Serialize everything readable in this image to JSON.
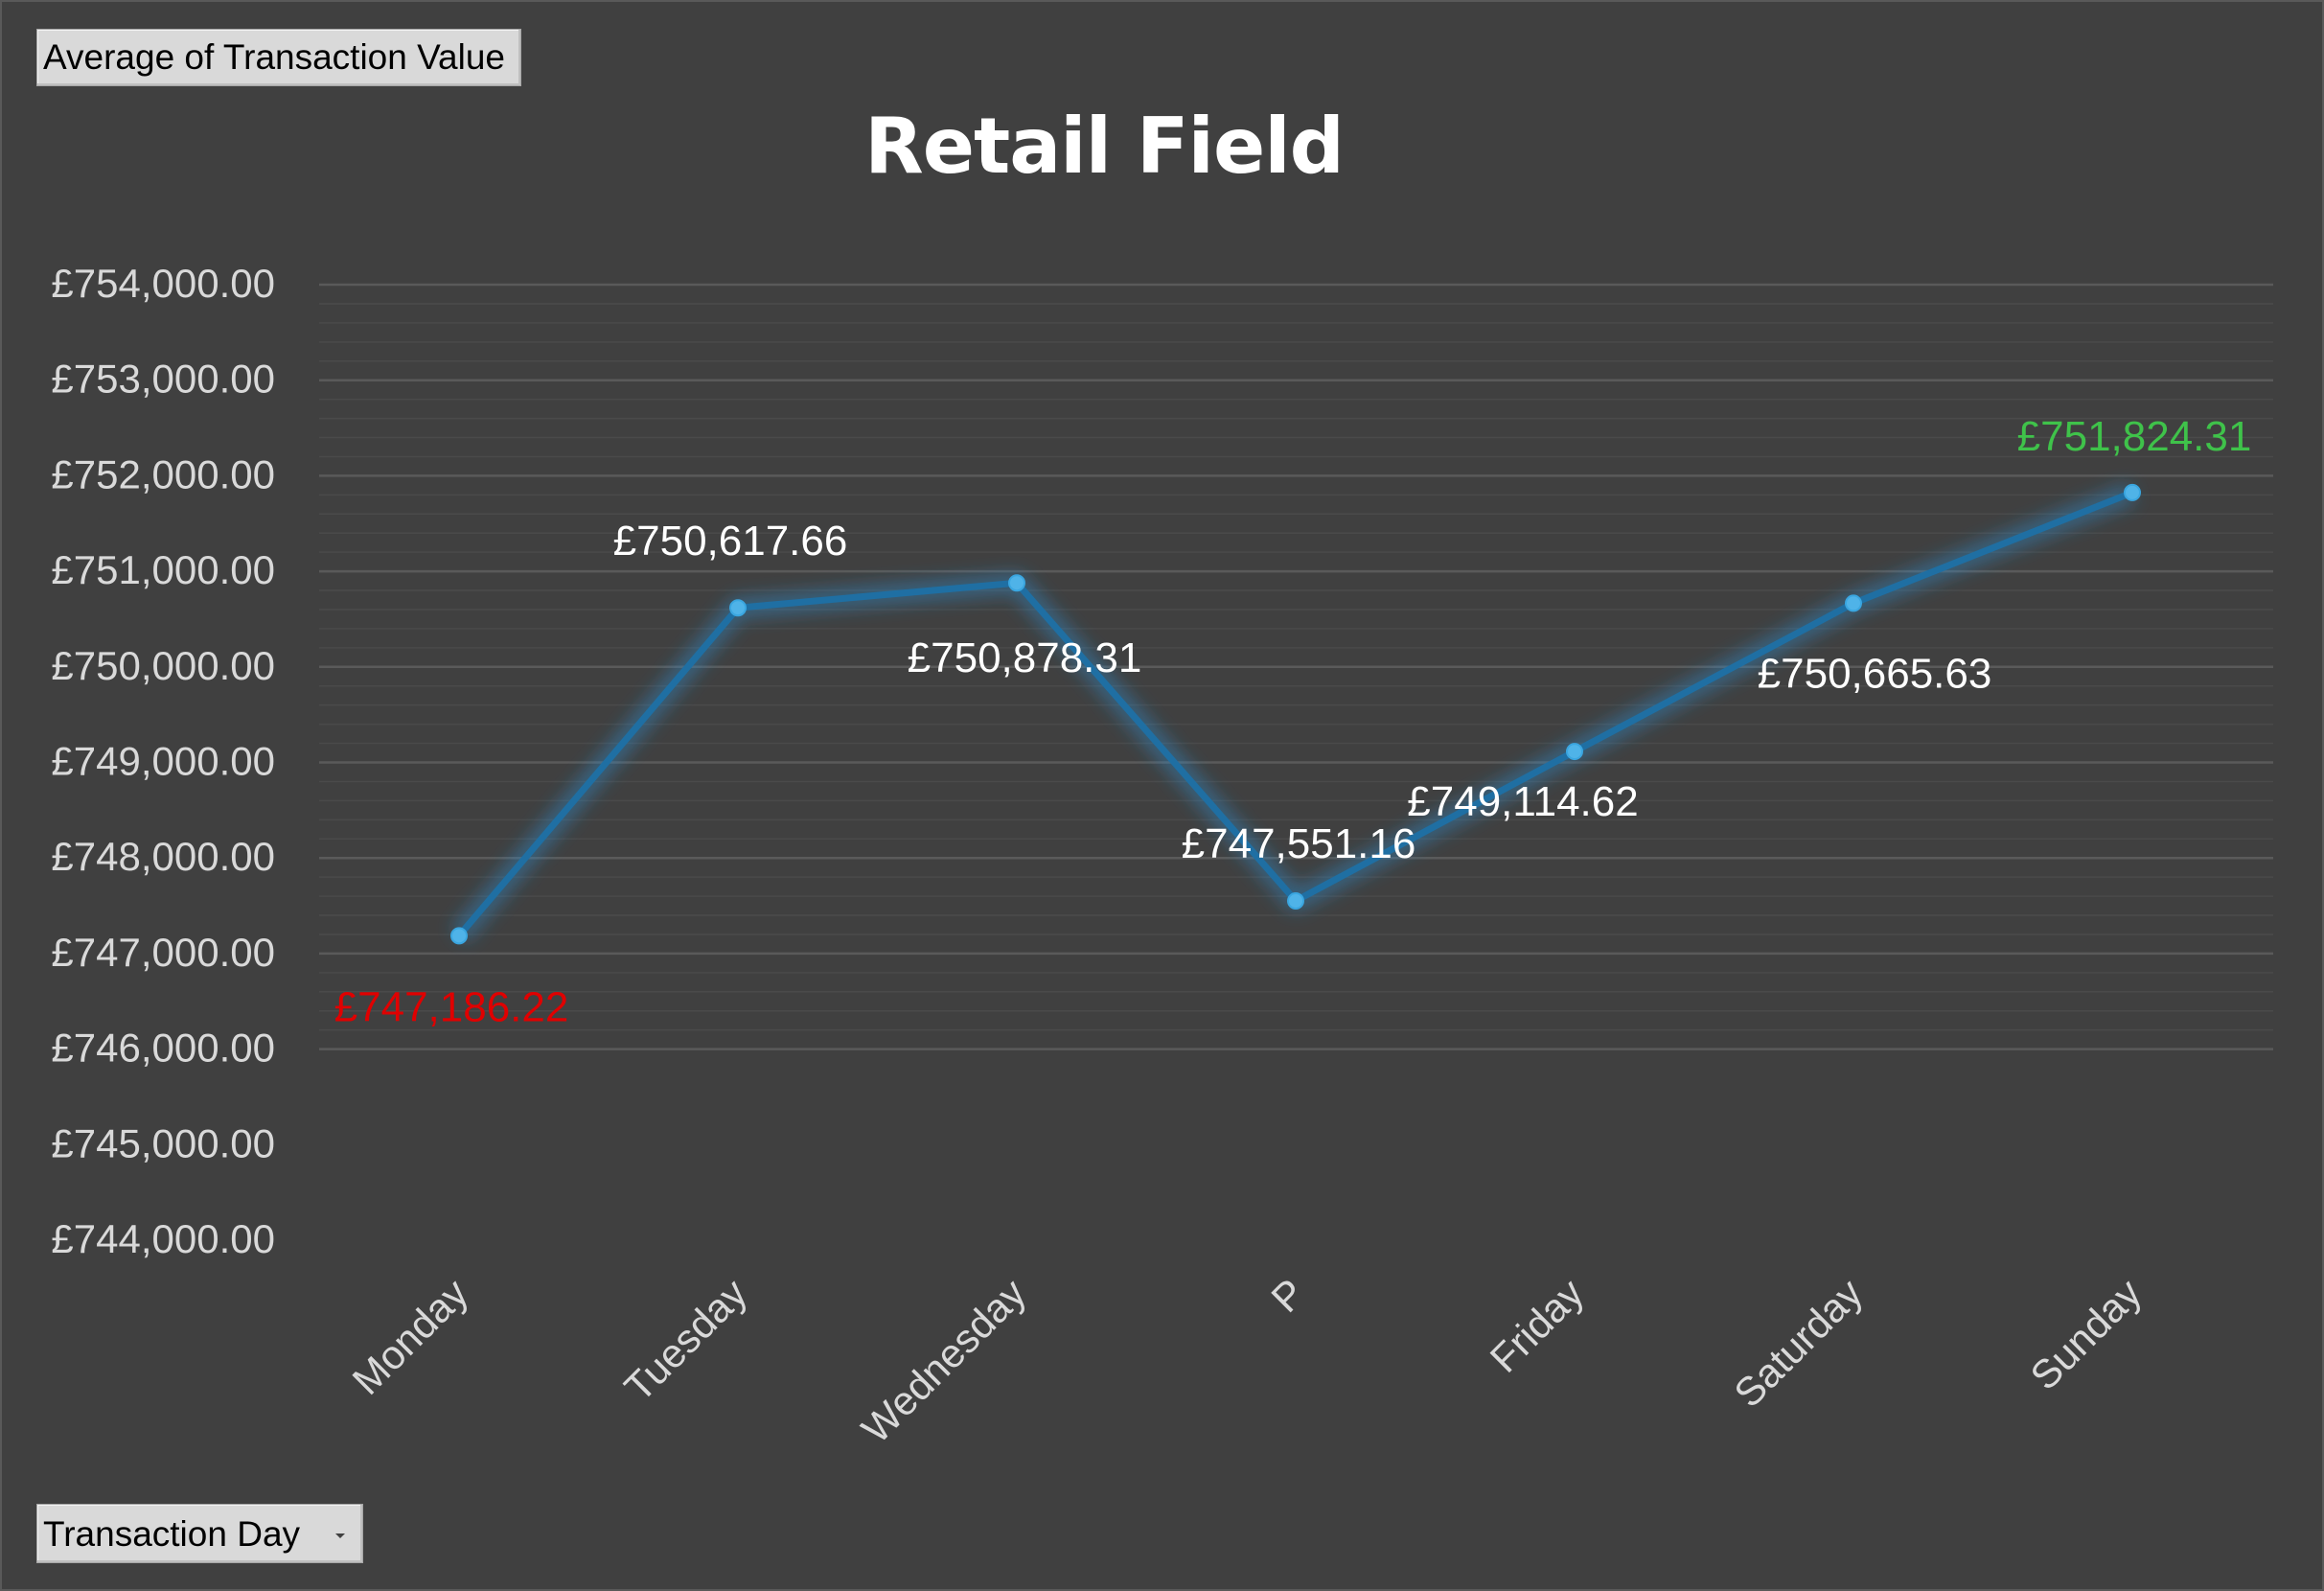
{
  "pivot": {
    "value_field": "Average of Transaction Value",
    "axis_field": "Transaction Day"
  },
  "chart_data": {
    "type": "line",
    "title": "Retail Field",
    "xlabel": "",
    "ylabel": "",
    "categories": [
      "Monday",
      "Tuesday",
      "Wednesday",
      "P",
      "Friday",
      "Saturday",
      "Sunday"
    ],
    "series": [
      {
        "values": [
          747186.22,
          750617.66,
          750878.31,
          747551.16,
          749114.62,
          750665.63,
          751824.31
        ]
      }
    ],
    "data_labels": [
      "£747,186.22",
      "£750,617.66",
      "£750,878.31",
      "£747,551.16",
      "£749,114.62",
      "£750,665.63",
      "£751,824.31"
    ],
    "ylim": [
      744000,
      754000
    ],
    "y_ticks": [
      754000,
      753000,
      752000,
      751000,
      750000,
      749000,
      748000,
      747000,
      746000,
      745000,
      744000
    ],
    "y_tick_labels": [
      "£754,000.00",
      "£753,000.00",
      "£752,000.00",
      "£751,000.00",
      "£750,000.00",
      "£749,000.00",
      "£748,000.00",
      "£747,000.00",
      "£746,000.00",
      "£745,000.00",
      "£744,000.00"
    ],
    "grid": true,
    "legend": "none",
    "colors": {
      "background": "#404040",
      "line": "#1f6fa3",
      "marker": "#4fb3e8",
      "label": "#ffffff",
      "min_label": "#e00000",
      "max_label": "#3fc24a",
      "tick_label": "#d9d9d9",
      "gridline": "#5a5a5a"
    }
  }
}
